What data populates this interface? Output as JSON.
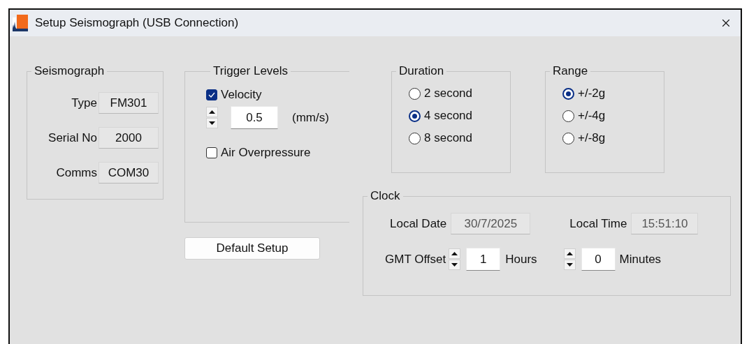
{
  "window": {
    "title": "Setup Seismograph (USB Connection)"
  },
  "seismograph": {
    "title": "Seismograph",
    "fields": [
      {
        "label": "Type",
        "value": "FM301"
      },
      {
        "label": "Serial No",
        "value": "2000"
      },
      {
        "label": "Comms",
        "value": "COM30"
      }
    ]
  },
  "trigger_levels": {
    "title": "Trigger Levels",
    "velocity": {
      "label": "Velocity",
      "checked": true
    },
    "velocity_value": "0.5",
    "unit": "(mm/s)",
    "air_overpressure": {
      "label": "Air Overpressure",
      "checked": false
    }
  },
  "default_button": "Default Setup",
  "duration": {
    "title": "Duration",
    "options": [
      {
        "label": "2 second",
        "selected": false
      },
      {
        "label": "4 second",
        "selected": true
      },
      {
        "label": "8 second",
        "selected": false
      }
    ]
  },
  "range": {
    "title": "Range",
    "options": [
      {
        "label": "+/-2g",
        "selected": true
      },
      {
        "label": "+/-4g",
        "selected": false
      },
      {
        "label": "+/-8g",
        "selected": false
      }
    ]
  },
  "clock": {
    "title": "Clock",
    "local_date": {
      "label": "Local Date",
      "value": "30/7/2025"
    },
    "local_time": {
      "label": "Local Time",
      "value": "15:51:10"
    },
    "gmt_offset": {
      "label": "GMT Offset",
      "hours": "1",
      "hours_unit": "Hours",
      "minutes": "0",
      "minutes_unit": "Minutes"
    }
  }
}
